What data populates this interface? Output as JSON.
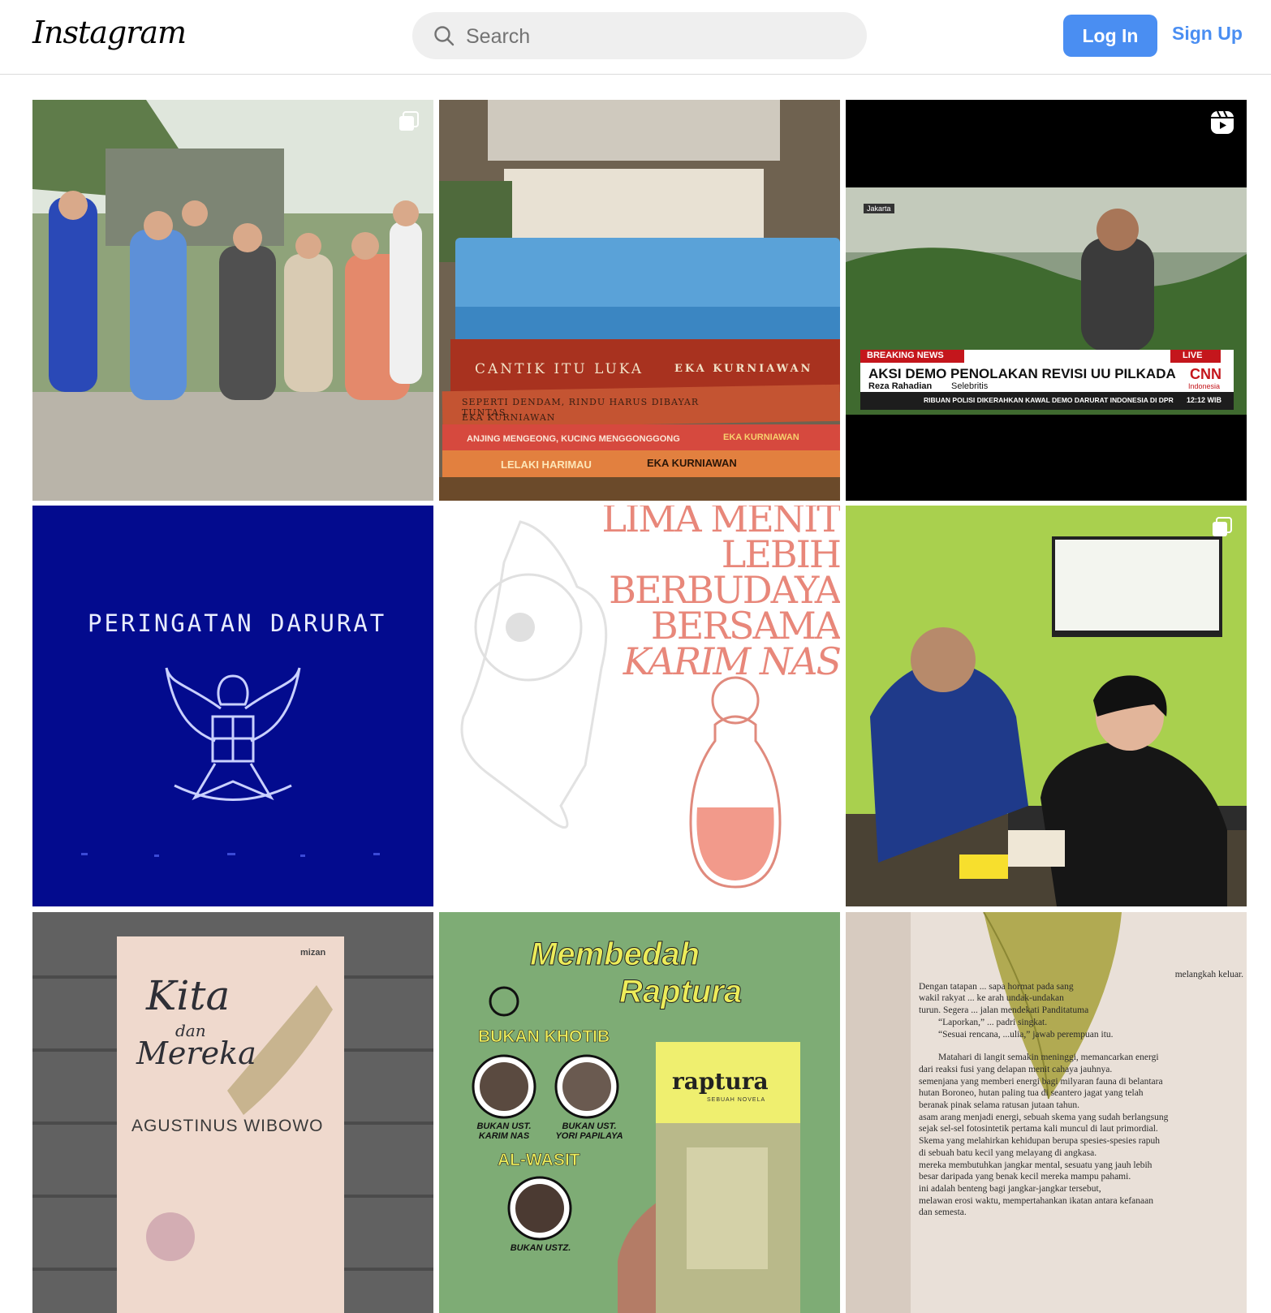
{
  "header": {
    "logo": "Instagram",
    "search_placeholder": "Search",
    "login_label": "Log In",
    "signup_label": "Sign Up"
  },
  "colors": {
    "accent": "#4a8ef2",
    "border": "#dbdbdb",
    "search_bg": "#efefef"
  },
  "posts": [
    {
      "type": "carousel",
      "icon": "carousel-icon"
    },
    {
      "type": "image",
      "books": [
        "CANTIK ITU LUKA",
        "EKA KURNIAWAN",
        "SEPERTI DENDAM, RINDU HARUS DIBAYAR TUNTAS",
        "EKA KURNIAWAN",
        "ANJING MENGEONG, KUCING MENGGONGGONG",
        "EKA KURNIAWAN",
        "LELAKI HARIMAU",
        "EKA KURNIAWAN"
      ]
    },
    {
      "type": "reel",
      "icon": "reel-icon",
      "location": "Jakarta",
      "ticker": "BREAKING NEWS",
      "live": "LIVE",
      "headline": "AKSI DEMO PENOLAKAN REVISI UU PILKADA",
      "name": "Reza Rahadian",
      "role": "Selebritis",
      "network": "CNN",
      "network_sub": "Indonesia",
      "crawl": "RIBUAN POLISI DIKERAHKAN KAWAL DEMO DARURAT INDONESIA DI DPR",
      "time": "12:12 WIB"
    },
    {
      "type": "image",
      "text": "PERINGATAN DARURAT"
    },
    {
      "type": "image",
      "lines": [
        "LIMA MENIT",
        "LEBIH",
        "BERBUDAYA",
        "BERSAMA",
        "KARIM NAS"
      ]
    },
    {
      "type": "carousel",
      "icon": "carousel-icon"
    },
    {
      "type": "image",
      "title1": "Kita",
      "title2": "dan",
      "title3": "Mereka",
      "author": "AGUSTINUS WIBOWO",
      "publisher": "mizan"
    },
    {
      "type": "image",
      "title1": "Membedah",
      "title2": "Raptura",
      "sub1": "BUKAN KHOTIB",
      "p1": "BUKAN UST. KARIM NAS",
      "p2": "BUKAN UST. YORI PAPILAYA",
      "sub2": "AL-WASIT",
      "p3": "BUKAN USTZ.",
      "book": "raptura",
      "book_sub": "SEBUAH NOVELA"
    },
    {
      "type": "image",
      "page_lines": [
        "melangkah keluar.",
        "Dengan tatapan ... sapa hormat pada sang",
        "wakil rakyat ... ke arah undak-undakan",
        "turun. Segera ... jalan mendekati Panditatuma",
        "“Laporkan,” ... padri singkat.",
        "“Sesuai rencana, ...ulia,” jawab perempuan itu.",
        "Matahari di langit semakin meninggi, memancarkan energi",
        "dari reaksi fusi yang delapan menit cahaya jauhnya.",
        "semenjana yang memberi energi bagi milyaran fauna di belantara",
        "hutan Boroneo, hutan paling tua di seantero jagat yang telah",
        "beranak pinak selama ratusan jutaan tahun.",
        "asam arang menjadi energi, sebuah skema yang sudah berlangsung",
        "sejak sel-sel fotosintetik pertama kali muncul di laut primordial.",
        "Skema yang melahirkan kehidupan berupa spesies-spesies rapuh",
        "di sebuah batu kecil yang melayang di angkasa.",
        "mereka membutuhkan jangkar mental, sesuatu yang jauh lebih",
        "besar daripada yang benak kecil mereka mampu pahami.",
        "ini adalah benteng bagi jangkar-jangkar tersebut,",
        "melawan erosi waktu, mempertahankan ikatan antara kefanaan",
        "dan semesta."
      ]
    }
  ]
}
